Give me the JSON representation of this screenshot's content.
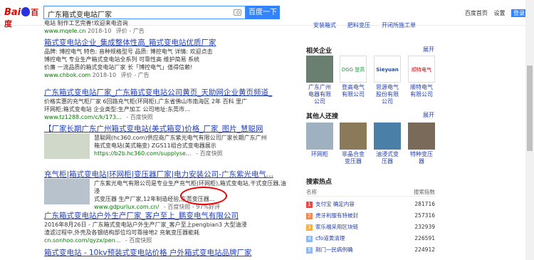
{
  "header": {
    "logo_bai": "Bai",
    "logo_du": "百度",
    "query": "广东箱式变电站厂家",
    "search_button": "百度一下",
    "links": [
      "百度首页",
      "设置",
      "登录"
    ]
  },
  "results": [
    {
      "title": "",
      "desc": "电站 制作工艺完善!欢迎来电咨询",
      "url": "www.mqele.cn",
      "date": "2018-10",
      "tags": "评价 - 广告"
    },
    {
      "title": "箱式变电站企业_集成整体性高_箱式变电站优质厂家",
      "desc1": "品牌: 博控电气  特色: 音种规格型号  品质: 博控电气  详情: 欢迎点击",
      "desc2": "博控电气  专业生产箱式变电站全系列 可靠性高 维护简易 系统",
      "desc3": "价廉 一流品质的箱式变电站厂家  长「博控电气」值得信赖!",
      "url": "www.chbok.com",
      "date": "2018-10",
      "tags": "评价 - 广告"
    },
    {
      "title": "广东箱式变电站厂家_广东箱式变电站公司黄页_天助网企业黄页频道_",
      "desc1": "价格实惠的充气柜厂家  6回路充气柜(环网柜),广东省佛山市南海区 2年 百科 里广",
      "desc2": "环网柜;箱式变电站 企业类型:生产加工 公司地址:东莞市...",
      "url": "www.tz1288.com/c/k/173...",
      "tags": "- 百度快照"
    },
    {
      "title": "【厂家长期广东广州箱式变电站(美式箱变)价格_厂家_图片_慧聪网",
      "desc1": "慧聪网(hc360.com)供应商广东紫光电气有限公司厂家长期广东广州",
      "desc2": "箱式变电站(美式箱变)  ZGS11组合式变电器展示",
      "url": "https://b2b.hc360.com/supplyse...",
      "tags": "- 百度快照"
    },
    {
      "title": "充气柜|箱式变电站|环网柜|变压器厂家|电力安装公司-广东紫光电气...",
      "desc1": "广东紫光电气有限公司是专业生产充气柜(环网柜),箱式变电站,干式变压器,油浸",
      "desc2": "式变压器 生产厂家,12年制造经验,东莞变压器...",
      "url": "www.gdpurlux.com.cn/",
      "tags": "- 百度快照 - 97%好评"
    },
    {
      "title": "广东箱式变电站户外生产厂家_客户至上_鹏变电气有限公司",
      "desc1": "2016年8月26日 - 广东箱式变电站户外生产厂家_客户至上pengbian3 大型油浸",
      "desc2": "渣滤过程中,外壳及各钢结构部位均可靠接地2 充氧变压器能耗",
      "url": "cn.sonhoo.com/qyzx/pen...",
      "tags": "- 百度快照"
    },
    {
      "title": "箱式变电站 - 10kv预装式变电站价格 户外箱式变电站品牌厂家"
    }
  ],
  "right": {
    "top_items": [
      "安装箱式",
      "肥料变压",
      "开闭所施工单"
    ],
    "related_title": "相关企业",
    "related_expand": "展开",
    "related": [
      {
        "name": "广东广州电器有限公司"
      },
      {
        "name": "登高电气有限公司",
        "logo": "DGG 登高"
      },
      {
        "name": "思源电气股份有限公司",
        "logo": "Sieyuan"
      },
      {
        "name": "顺特电气有限公司",
        "logo": "顺特电气"
      }
    ],
    "others_title": "其他人还搜",
    "others_expand": "展开",
    "others": [
      "环网柜",
      "非晶合金变压器",
      "油浸式变压器",
      "特种变压器"
    ],
    "hot_title": "搜索热点",
    "hot_header_name": "名称",
    "hot_header_count": "搜索指数",
    "hot": [
      {
        "rank": "1",
        "text": "支付宝 确定内容",
        "count": "281716",
        "color": "#f54545"
      },
      {
        "rank": "2",
        "text": "虎牙利服有特被封",
        "count": "257316",
        "color": "#ff8547"
      },
      {
        "rank": "3",
        "text": "家乐福采用区块链",
        "count": "232939",
        "color": "#ffac38"
      },
      {
        "rank": "4",
        "text": "cfo道黄清理",
        "count": "226591",
        "color": "#8eb9f5"
      },
      {
        "rank": "5",
        "text": "荆门一民病例确",
        "count": "224912",
        "color": "#8eb9f5"
      }
    ]
  }
}
